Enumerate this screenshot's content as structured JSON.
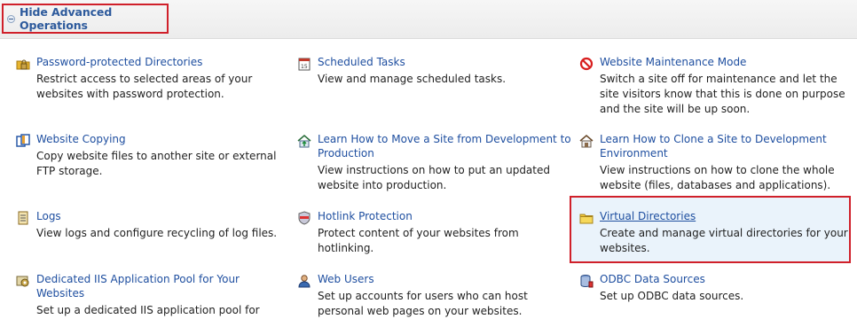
{
  "toggle": {
    "label": "Hide Advanced Operations"
  },
  "items": [
    {
      "title": "Password-protected Directories",
      "desc": "Restrict access to selected areas of your websites with password protection."
    },
    {
      "title": "Scheduled Tasks",
      "desc": "View and manage scheduled tasks."
    },
    {
      "title": "Website Maintenance Mode",
      "desc": "Switch a site off for maintenance and let the site visitors know that this is done on purpose and the site will be up soon."
    },
    {
      "title": "Website Copying",
      "desc": "Copy website files to another site or external FTP storage."
    },
    {
      "title": "Learn How to Move a Site from Development to Production",
      "desc": "View instructions on how to put an updated website into production."
    },
    {
      "title": "Learn How to Clone a Site to Development Environment",
      "desc": "View instructions on how to clone the whole website (files, databases and applications)."
    },
    {
      "title": "Logs",
      "desc": "View logs and configure recycling of log files."
    },
    {
      "title": "Hotlink Protection",
      "desc": "Protect content of your websites from hotlinking."
    },
    {
      "title": "Virtual Directories",
      "desc": "Create and manage virtual directories for your websites."
    },
    {
      "title": "Dedicated IIS Application Pool for Your Websites",
      "desc": "Set up a dedicated IIS application pool for"
    },
    {
      "title": "Web Users",
      "desc": "Set up accounts for users who can host personal web pages on your websites."
    },
    {
      "title": "ODBC Data Sources",
      "desc": "Set up ODBC data sources."
    }
  ],
  "icons": {
    "0": "lock-folder-icon",
    "1": "calendar-icon",
    "2": "no-entry-icon",
    "3": "copy-icon",
    "4": "house-upload-icon",
    "5": "house-clone-icon",
    "6": "log-icon",
    "7": "shield-icon",
    "8": "folder-icon",
    "9": "app-pool-icon",
    "10": "user-icon",
    "11": "database-icon"
  }
}
